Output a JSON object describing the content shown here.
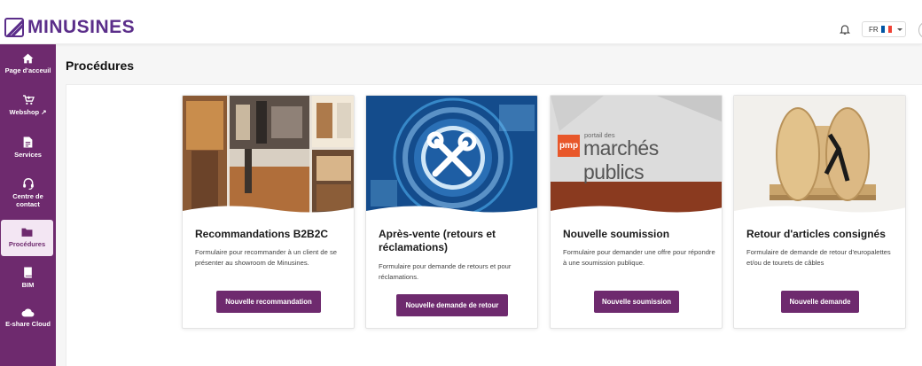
{
  "header": {
    "logo_text": "MINUSINES",
    "language": "FR",
    "flag_colors": [
      "#0055a4",
      "#ffffff",
      "#ef4135"
    ]
  },
  "sidebar": {
    "accent": "#6e2a6e",
    "items": [
      {
        "label": "Page d'acceuil",
        "icon": "home-icon"
      },
      {
        "label": "Webshop ↗",
        "icon": "cart-icon"
      },
      {
        "label": "Services",
        "icon": "document-icon"
      },
      {
        "label": "Centre de contact",
        "icon": "headset-icon"
      },
      {
        "label": "Procédures",
        "icon": "folder-icon",
        "active": true
      },
      {
        "label": "BIM",
        "icon": "book-icon"
      },
      {
        "label": "E-share Cloud",
        "icon": "cloud-icon"
      }
    ]
  },
  "main": {
    "title": "Procédures",
    "cards": [
      {
        "title": "Recommandations B2B2C",
        "description": "Formulaire pour recommander à un client de se présenter au showroom de Minusines.",
        "button": "Nouvelle recommandation",
        "image": "showroom-photo"
      },
      {
        "title": "Après-vente (retours et réclamations)",
        "description": "Formulaire pour demande de retours et pour réclamations.",
        "button": "Nouvelle demande de retour",
        "image": "tools-tech-illustration"
      },
      {
        "title": "Nouvelle soumission",
        "description": "Formulaire pour demander une offre pour répondre à une soumission publique.",
        "button": "Nouvelle soumission",
        "image": "marches-publics-banner",
        "image_logo": "pmp",
        "image_small": "portail des",
        "image_big": "marchés publics"
      },
      {
        "title": "Retour d'articles consignés",
        "description": "Formulaire de demande de retour d'europalettes et/ou de tourets de câbles",
        "button": "Nouvelle demande",
        "image": "cable-reel-photo"
      }
    ]
  }
}
